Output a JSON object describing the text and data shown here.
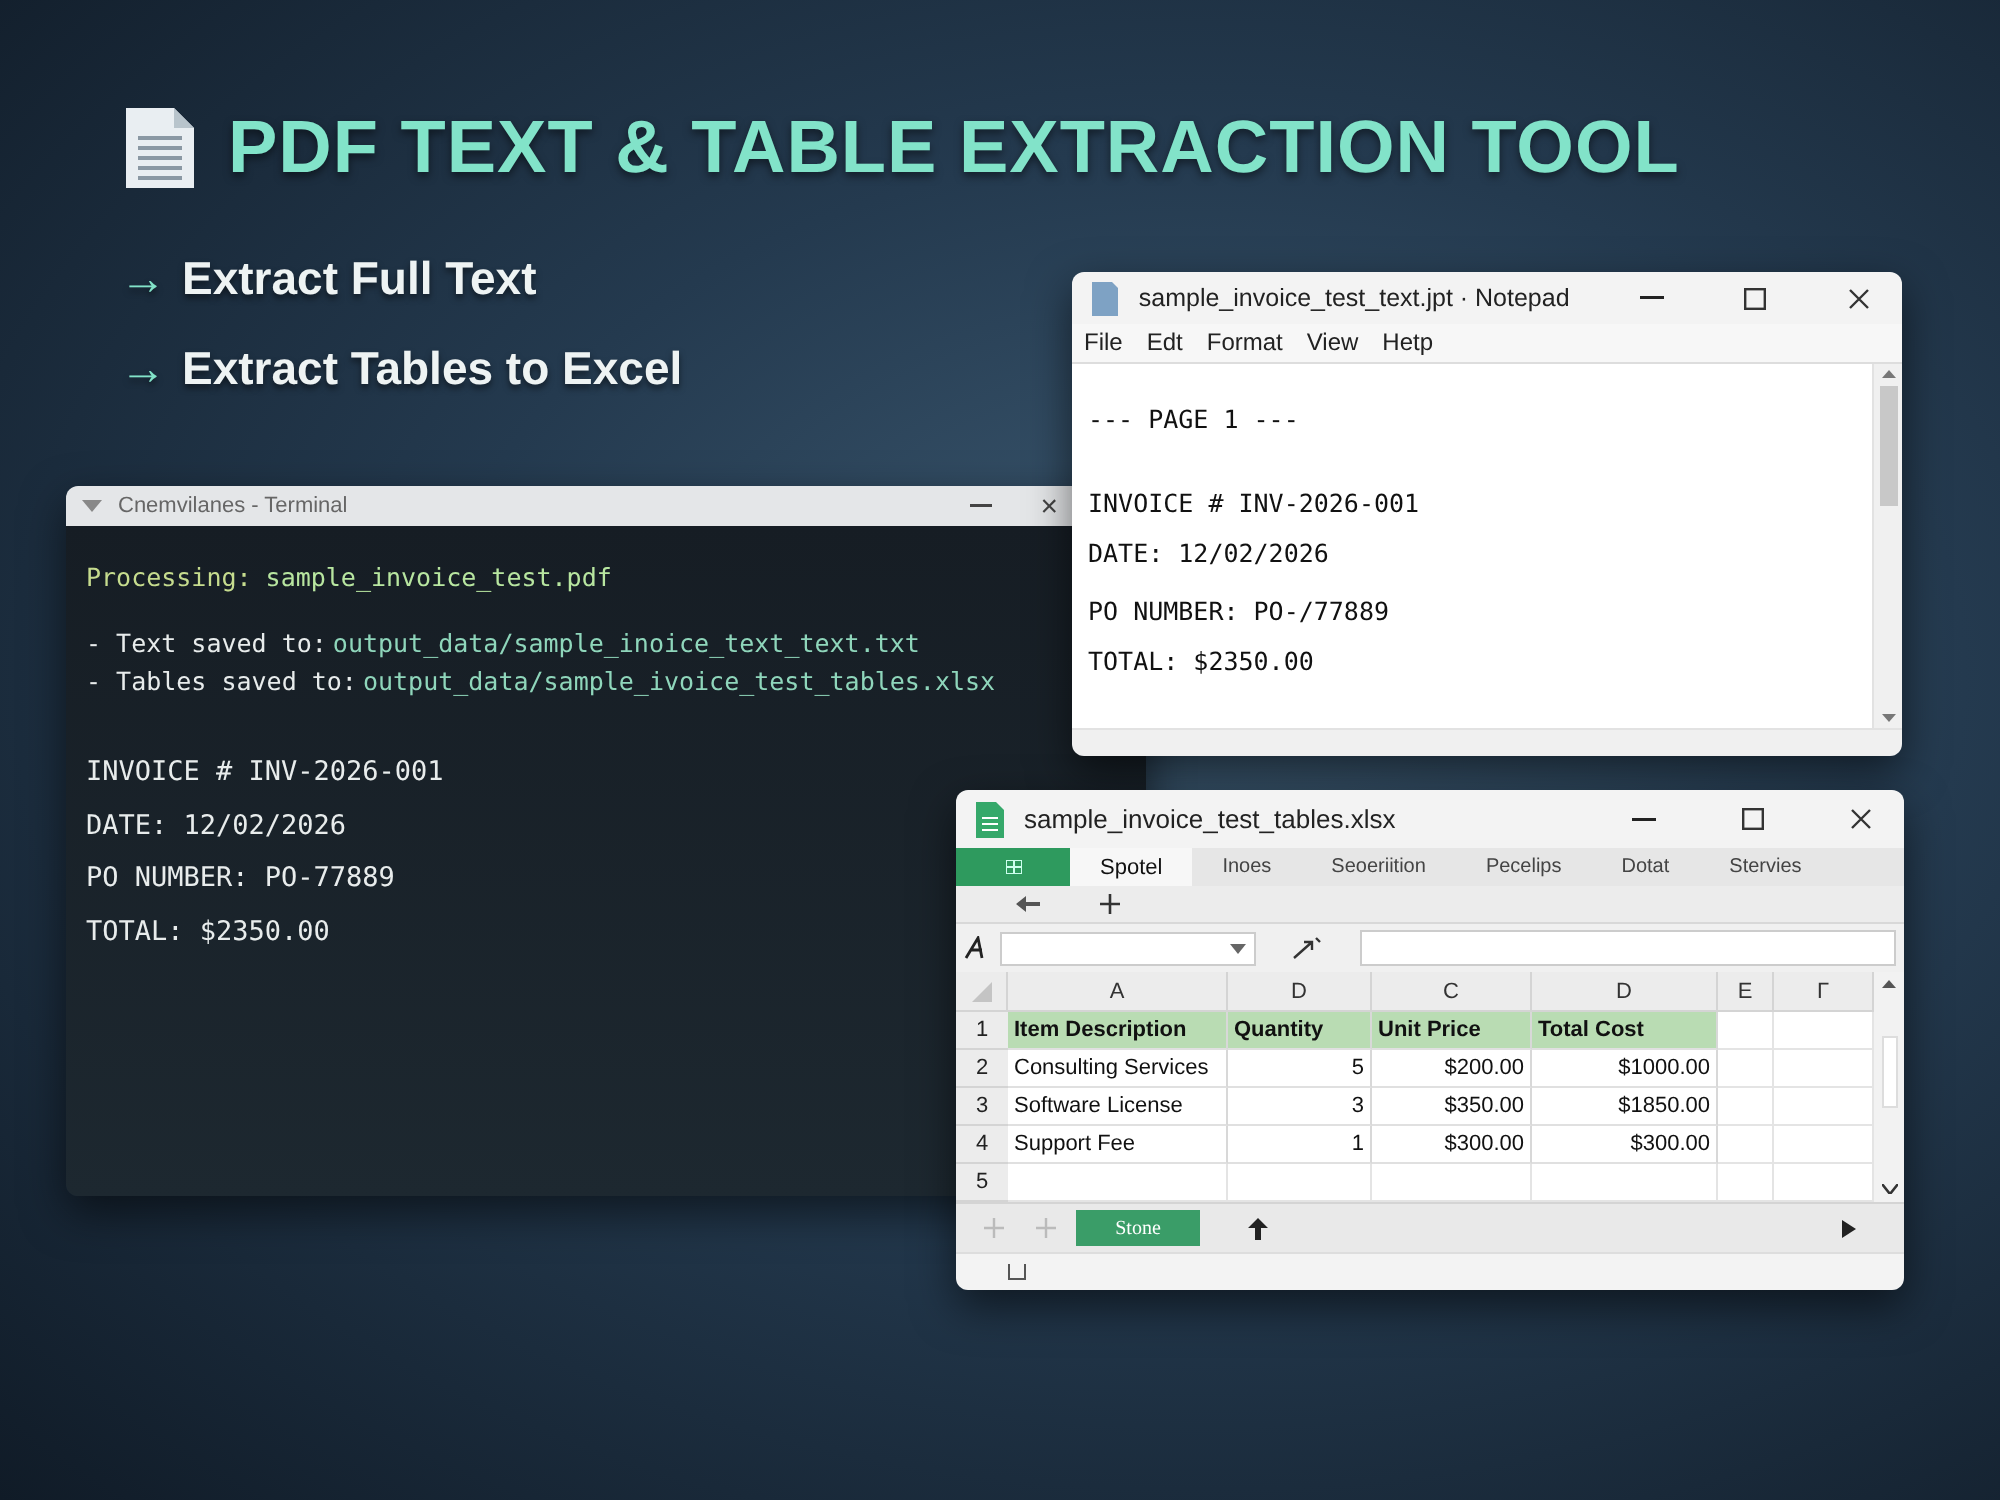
{
  "header": {
    "title": "PDF TEXT & TABLE EXTRACTION TOOL"
  },
  "features": [
    {
      "arrow": "→",
      "label": "Extract Full Text"
    },
    {
      "arrow": "→",
      "label": "Extract Tables to Excel"
    }
  ],
  "terminal": {
    "title": "Cnemvilanes - Terminal",
    "close": "×",
    "status": {
      "label": "Processing:",
      "value": "sample_invoice_test.pdf"
    },
    "saved": [
      {
        "label": "- Text saved to:",
        "value": "output_data/sample_inoice_text_text.txt"
      },
      {
        "label": "- Tables saved to:",
        "value": "output_data/sample_ivoice_test_tables.xlsx"
      }
    ],
    "output": [
      "INVOICE # INV-2026-001",
      "DATE: 12/02/2026",
      "PO NUMBER: PO-77889",
      "TOTAL: $2350.00"
    ]
  },
  "notepad": {
    "title": "sample_invoice_test_text.jpt · Notepad",
    "menu": [
      "File",
      "Edt",
      "Format",
      "View",
      "Hetp"
    ],
    "lines": [
      "--- PAGE 1 ---",
      "INVOICE #  INV-2026-001",
      "DATE:  12/02/2026",
      "PO NUMBER:  PO-/77889",
      "TOTAL:  $2350.00"
    ]
  },
  "spreadsheet": {
    "title": "sample_invoice_test_tables.xlsx",
    "ribbon_tabs": [
      {
        "label": "Spotel",
        "selected": true
      },
      {
        "label": "Inoes",
        "selected": false
      },
      {
        "label": "Seoeriition",
        "selected": false
      },
      {
        "label": "Pecelips",
        "selected": false
      },
      {
        "label": "Dotat",
        "selected": false
      },
      {
        "label": "Stervies",
        "selected": false
      }
    ],
    "columns": [
      "A",
      "D",
      "C",
      "D",
      "E",
      "Г"
    ],
    "rows": [
      {
        "number": "1",
        "kind": "header",
        "cells": [
          "Item Description",
          "Quantity",
          "Unit Price",
          "Total Cost"
        ]
      },
      {
        "number": "2",
        "kind": "data",
        "cells": [
          "Consulting Services",
          "5",
          "$200.00",
          "$1000.00"
        ]
      },
      {
        "number": "3",
        "kind": "data",
        "cells": [
          "Software License",
          "3",
          "$350.00",
          "$1850.00"
        ]
      },
      {
        "number": "4",
        "kind": "data",
        "cells": [
          "Support Fee",
          "1",
          "$300.00",
          "$300.00"
        ]
      },
      {
        "number": "5",
        "cells": []
      }
    ],
    "sheet_tabs": [
      {
        "label": "Stone",
        "selected": true
      }
    ]
  }
}
